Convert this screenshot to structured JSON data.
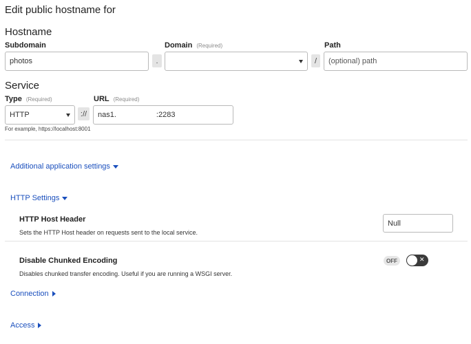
{
  "header": {
    "title": "Edit public hostname for"
  },
  "hostname": {
    "section_title": "Hostname",
    "subdomain": {
      "label": "Subdomain",
      "value": "photos"
    },
    "dot_separator": ".",
    "domain": {
      "label": "Domain",
      "required": "(Required)",
      "value": ""
    },
    "slash_separator": "/",
    "path": {
      "label": "Path",
      "placeholder": "(optional) path"
    }
  },
  "service": {
    "section_title": "Service",
    "type": {
      "label": "Type",
      "required": "(Required)",
      "value": "HTTP"
    },
    "scheme_separator": "://",
    "url": {
      "label": "URL",
      "required": "(Required)",
      "value": "nas1.",
      "port": ":2283"
    },
    "hint": "For example, https://localhost:8001"
  },
  "links": {
    "additional_settings": "Additional application settings",
    "http_settings": "HTTP Settings",
    "connection": "Connection",
    "access": "Access"
  },
  "http_settings": {
    "host_header": {
      "title": "HTTP Host Header",
      "description": "Sets the HTTP Host header on requests sent to the local service.",
      "value": "Null"
    },
    "chunked_encoding": {
      "title": "Disable Chunked Encoding",
      "description": "Disables chunked transfer encoding. Useful if you are running a WSGI server.",
      "state_label": "OFF",
      "toggle_symbol": "✕"
    }
  },
  "colors": {
    "link": "#1a4fbd",
    "toggle": "#3b3b3b"
  }
}
